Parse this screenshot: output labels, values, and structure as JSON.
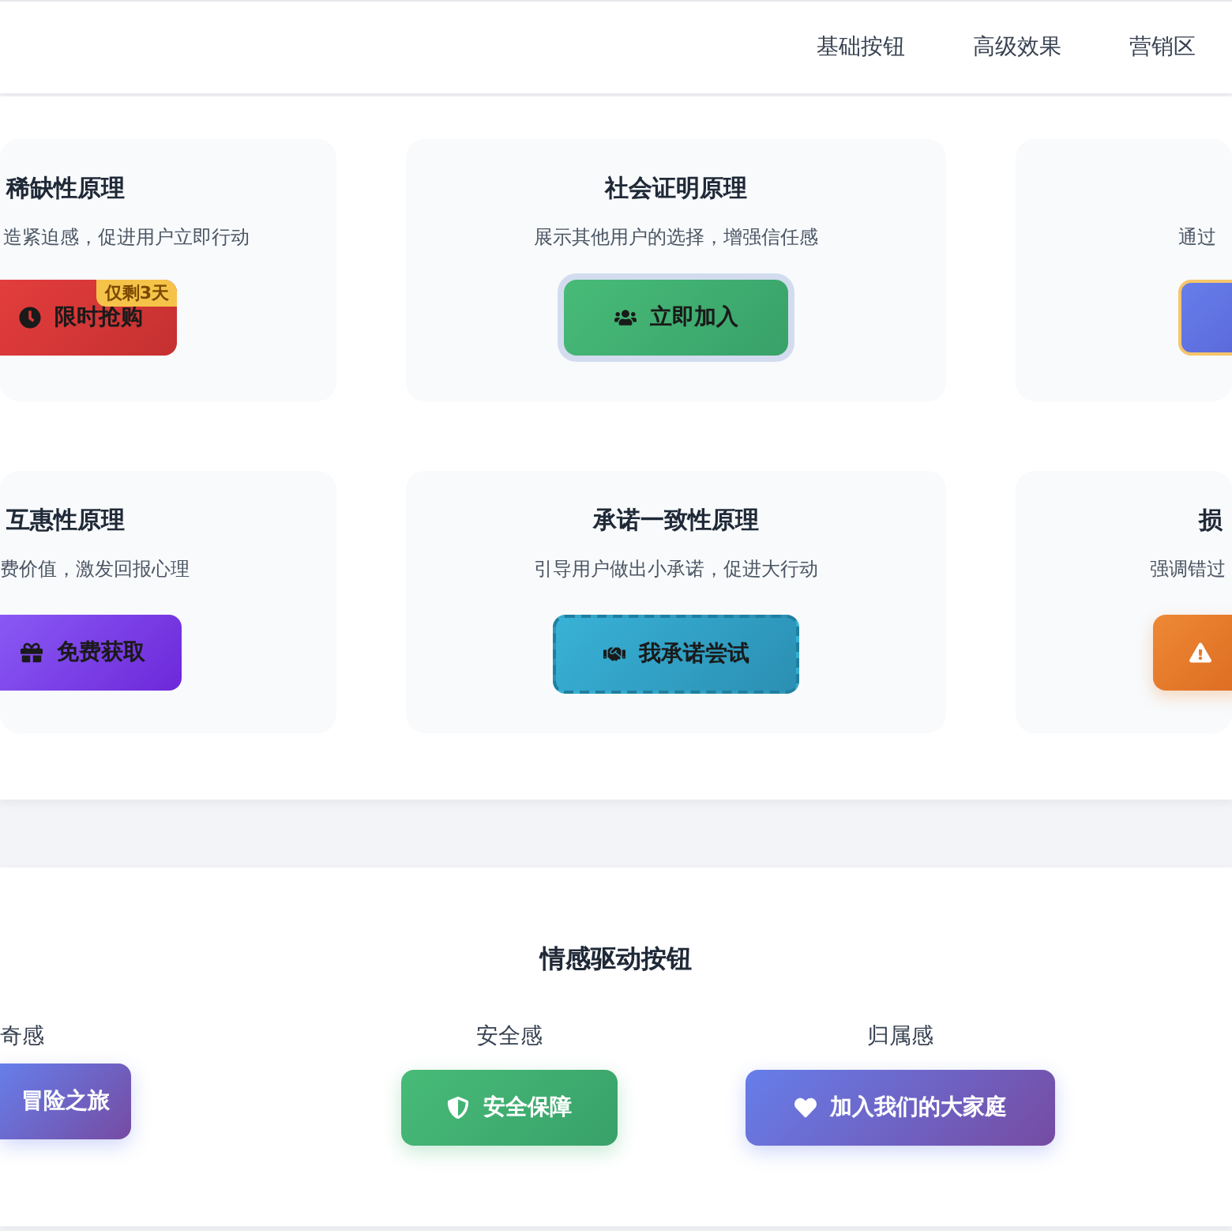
{
  "nav": [
    {
      "label": "基础按钮"
    },
    {
      "label": "高级效果"
    },
    {
      "label": "营销区"
    }
  ],
  "principles": [
    {
      "kind": "scarcity",
      "title": "稀缺性原理",
      "description": "造紧迫感，促进用户立即行动",
      "button": "限时抢购",
      "badge": "仅剩3天"
    },
    {
      "kind": "social",
      "title": "社会证明原理",
      "description": "展示其他用户的选择，增强信任感",
      "button": "立即加入"
    },
    {
      "kind": "authority",
      "description": "通过"
    },
    {
      "kind": "reciprocity",
      "title": "互惠性原理",
      "description": "费价值，激发回报心理",
      "button": "免费获取"
    },
    {
      "kind": "commitment",
      "title": "承诺一致性原理",
      "description": "引导用户做出小承诺，促进大行动",
      "button": "我承诺尝试"
    },
    {
      "kind": "loss",
      "title": "损",
      "description": "强调错过"
    }
  ],
  "emotion": {
    "title": "情感驱动按钮",
    "items": [
      {
        "kind": "adventure",
        "label": "奇感",
        "button": "冒险之旅"
      },
      {
        "kind": "security",
        "label": "安全感",
        "button": "安全保障"
      },
      {
        "kind": "belonging",
        "label": "归属感",
        "button": "加入我们的大家庭"
      }
    ]
  }
}
